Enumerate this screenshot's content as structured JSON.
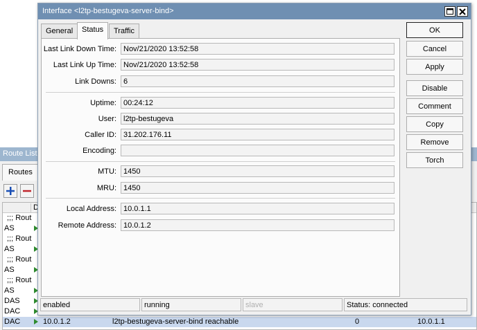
{
  "background_window": {
    "title": "Route List",
    "tab": "Routes",
    "toolbar": {
      "add_icon": "plus-icon",
      "remove_icon": "minus-icon"
    },
    "grid": {
      "header_col": "D",
      "rows": [
        {
          "type": "comment",
          "text": ";;; Rout"
        },
        {
          "type": "data",
          "flag": "AS"
        },
        {
          "type": "comment",
          "text": ";;; Rout"
        },
        {
          "type": "data",
          "flag": "AS"
        },
        {
          "type": "comment",
          "text": ";;; Rout"
        },
        {
          "type": "data",
          "flag": "AS"
        },
        {
          "type": "comment",
          "text": ";;; Rout"
        },
        {
          "type": "data",
          "flag": "AS"
        },
        {
          "type": "data",
          "flag": "DAS"
        },
        {
          "type": "data",
          "flag": "DAC"
        }
      ],
      "selected_row": {
        "flag": "DAC",
        "dst": "10.0.1.2",
        "gateway": "l2tp-bestugeva-server-bind reachable",
        "distance": "0",
        "pref_src": "10.0.1.1"
      }
    }
  },
  "dialog": {
    "title": "Interface <l2tp-bestugeva-server-bind>",
    "titlebar_icons": [
      "maximize-icon",
      "close-icon"
    ],
    "tabs": [
      {
        "label": "General"
      },
      {
        "label": "Status"
      },
      {
        "label": "Traffic"
      }
    ],
    "active_tab": "Status",
    "fields": {
      "last_link_down_time": {
        "label": "Last Link Down Time:",
        "value": "Nov/21/2020 13:52:58"
      },
      "last_link_up_time": {
        "label": "Last Link Up Time:",
        "value": "Nov/21/2020 13:52:58"
      },
      "link_downs": {
        "label": "Link Downs:",
        "value": "6"
      },
      "uptime": {
        "label": "Uptime:",
        "value": "00:24:12"
      },
      "user": {
        "label": "User:",
        "value": "l2tp-bestugeva"
      },
      "caller_id": {
        "label": "Caller ID:",
        "value": "31.202.176.11"
      },
      "encoding": {
        "label": "Encoding:",
        "value": ""
      },
      "mtu": {
        "label": "MTU:",
        "value": "1450"
      },
      "mru": {
        "label": "MRU:",
        "value": "1450"
      },
      "local_address": {
        "label": "Local Address:",
        "value": "10.0.1.1"
      },
      "remote_address": {
        "label": "Remote Address:",
        "value": "10.0.1.2"
      }
    },
    "buttons": {
      "ok": "OK",
      "cancel": "Cancel",
      "apply": "Apply",
      "disable": "Disable",
      "comment": "Comment",
      "copy": "Copy",
      "remove": "Remove",
      "torch": "Torch"
    },
    "statusbar": {
      "state": "enabled",
      "running": "running",
      "slave": "slave",
      "status": "Status: connected"
    }
  }
}
